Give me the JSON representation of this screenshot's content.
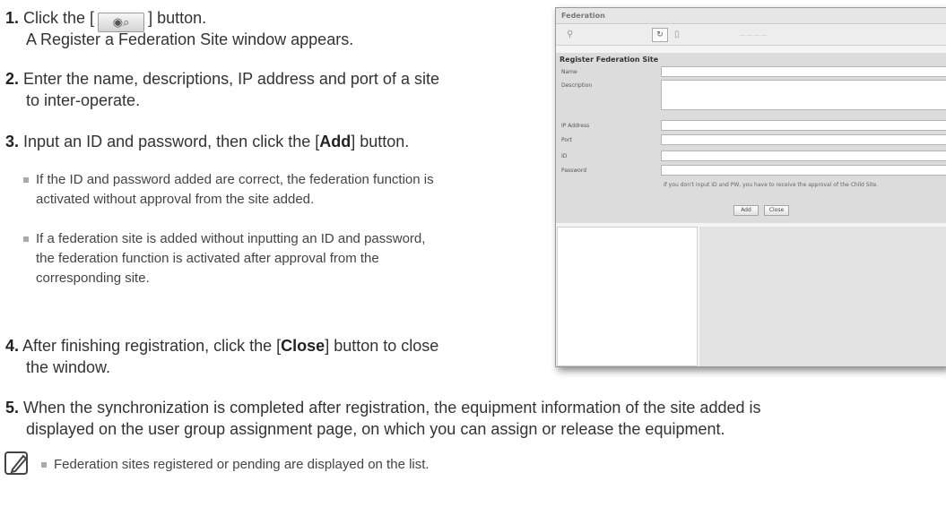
{
  "steps": [
    {
      "num": "1.",
      "line1_pre": "Click the [",
      "line1_post": "] button.",
      "line2": "A Register a Federation Site window appears."
    },
    {
      "num": "2.",
      "line1": "Enter the name, descriptions, IP address and port of a site",
      "line2": "to inter-operate."
    },
    {
      "num": "3.",
      "pre": "Input an ID and password, then click the [",
      "bold": "Add",
      "post": "] button."
    },
    {
      "num": "4.",
      "pre": "After finishing registration, click the [",
      "bold": "Close",
      "post": "] button to close",
      "line2": "the window."
    },
    {
      "num": "5.",
      "line1": "When the synchronization is completed after registration, the equipment information of the site added is",
      "line2": "displayed on the user group assignment page, on which you can assign or release the equipment."
    }
  ],
  "bullets": [
    {
      "line1": "If the ID and password added are correct, the federation function is",
      "line2": "activated without approval from the site added."
    },
    {
      "line1": "If a federation site is added without inputting an ID and password,",
      "line2": "the federation function is activated after approval from the",
      "line3": "corresponding site."
    }
  ],
  "note_text": "Federation sites registered or pending are displayed on the list.",
  "screenshot": {
    "window_title": "Federation",
    "dialog_title": "Register Federation Site",
    "labels": {
      "name": "Name",
      "description": "Description",
      "ip": "IP Address",
      "port": "Port",
      "id": "ID",
      "password": "Password"
    },
    "note": "If you don't input ID and PW, you have to receive the approval of the Child Site.",
    "add": "Add",
    "close": "Close"
  }
}
